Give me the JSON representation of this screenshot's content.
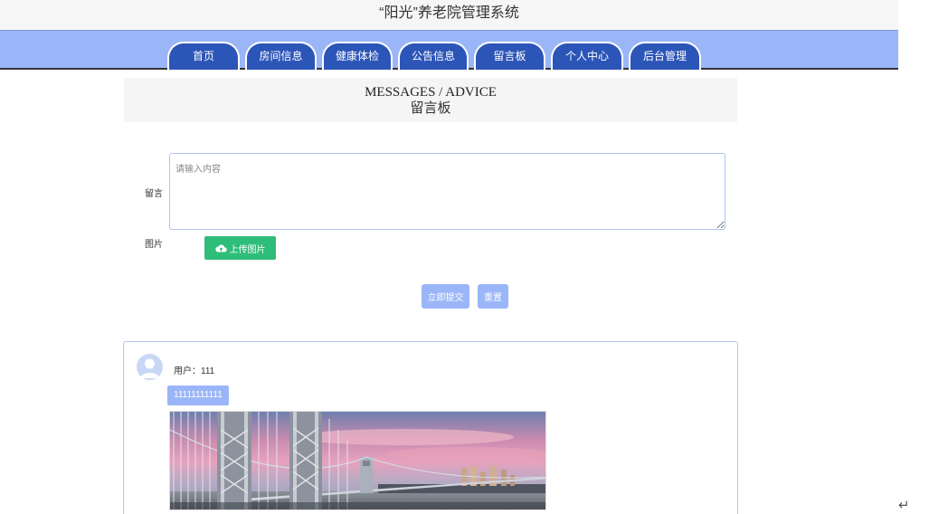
{
  "header": {
    "title": "“阳光”养老院管理系统"
  },
  "nav": {
    "items": [
      {
        "label": "首页"
      },
      {
        "label": "房间信息"
      },
      {
        "label": "健康体检"
      },
      {
        "label": "公告信息"
      },
      {
        "label": "留言板"
      },
      {
        "label": "个人中心"
      },
      {
        "label": "后台管理"
      }
    ]
  },
  "section": {
    "title_en": "MESSAGES / ADVICE",
    "title_cn": "留言板"
  },
  "form": {
    "message_label": "留言",
    "message_placeholder": "请输入内容",
    "message_value": "",
    "image_label": "图片",
    "upload_label": "上传图片",
    "upload_icon": "cloud-upload-icon",
    "submit_label": "立即提交",
    "reset_label": "重置"
  },
  "messages": [
    {
      "user_line": "用户：111",
      "content": "11111111111",
      "avatar_icon": "user-avatar-icon",
      "image_subject": "bridge-photo"
    }
  ],
  "colors": {
    "nav_bg": "#9bb6f8",
    "nav_tab": "#2c55b8",
    "accent_green": "#2fbd7a",
    "accent_blue": "#9bb6f8"
  },
  "misc": {
    "return_glyph": "↵"
  }
}
